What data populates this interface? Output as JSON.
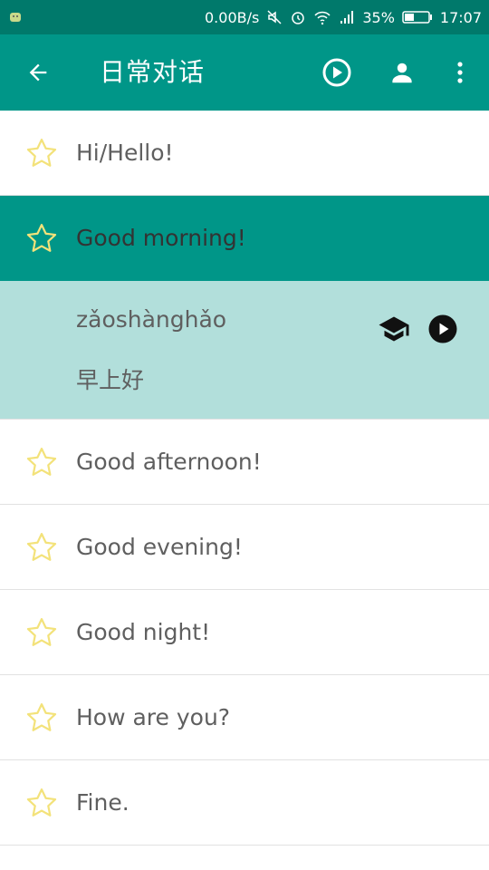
{
  "status_bar": {
    "network_speed": "0.00B/s",
    "battery": "35%",
    "time": "17:07"
  },
  "app_bar": {
    "title": "日常对话",
    "icons": [
      "back-arrow-icon",
      "play-circle-icon",
      "person-icon",
      "more-vert-icon"
    ]
  },
  "phrases": [
    {
      "text": "Hi/Hello!"
    },
    {
      "text": "Good morning!",
      "expanded": true
    },
    {
      "text": "Good afternoon!"
    },
    {
      "text": "Good evening!"
    },
    {
      "text": "Good night!"
    },
    {
      "text": "How are you?"
    },
    {
      "text": "Fine."
    }
  ],
  "expanded_detail": {
    "pinyin": "zǎoshànghǎo",
    "chinese": "早上好"
  },
  "colors": {
    "primary": "#009688",
    "primary_dark": "#00796b",
    "expanded_bg": "#b2dfdb",
    "star_outline": "#f3e27a",
    "text": "#5f5f5f"
  }
}
